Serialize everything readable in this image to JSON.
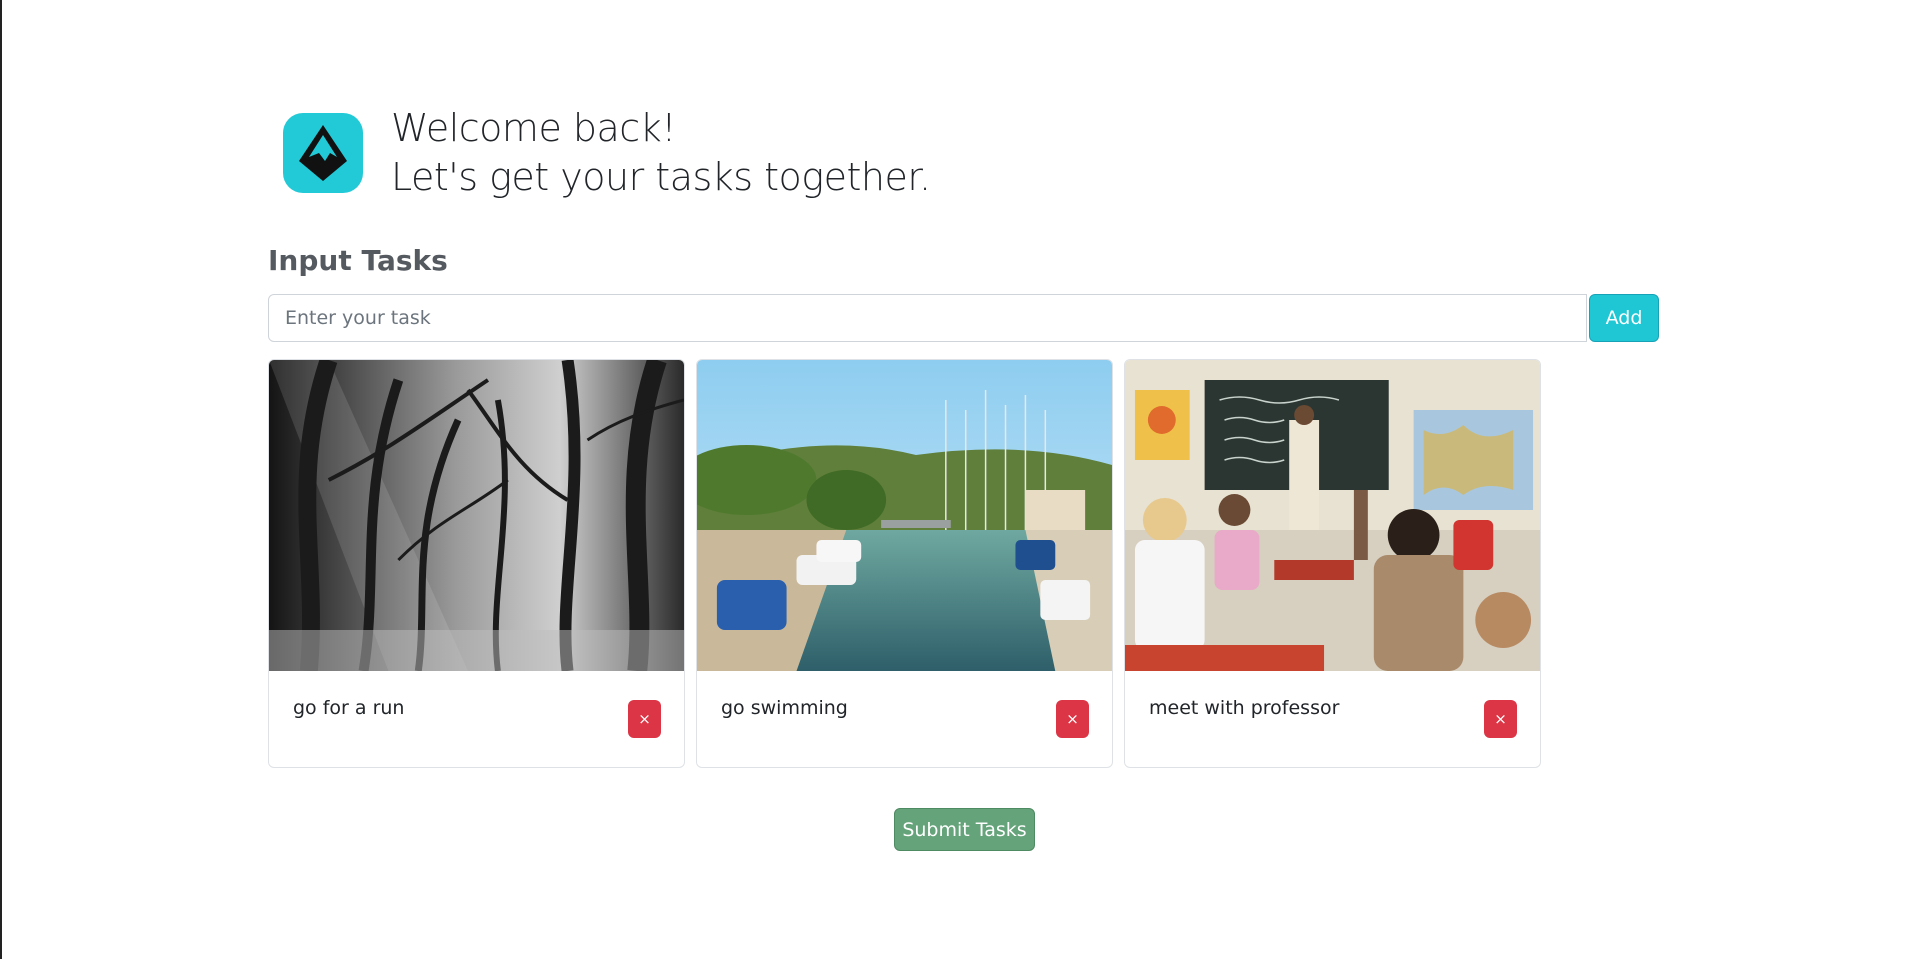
{
  "hero": {
    "line1": "Welcome back!",
    "line2": "Let's get your tasks together.",
    "logo_icon": "mountain-icon",
    "accent_color": "#22c9d6"
  },
  "input_section": {
    "title": "Input Tasks",
    "placeholder": "Enter your task",
    "value": "",
    "add_label": "Add"
  },
  "tasks": [
    {
      "label": "go for a run",
      "image": "black-and-white forest",
      "delete_label": "×"
    },
    {
      "label": "go swimming",
      "image": "harbor with boats",
      "delete_label": "×"
    },
    {
      "label": "meet with professor",
      "image": "classroom with teacher",
      "delete_label": "×"
    }
  ],
  "submit_label": "Submit Tasks",
  "colors": {
    "add": "#1fc7d4",
    "delete": "#dc3545",
    "submit": "#65a37a"
  }
}
